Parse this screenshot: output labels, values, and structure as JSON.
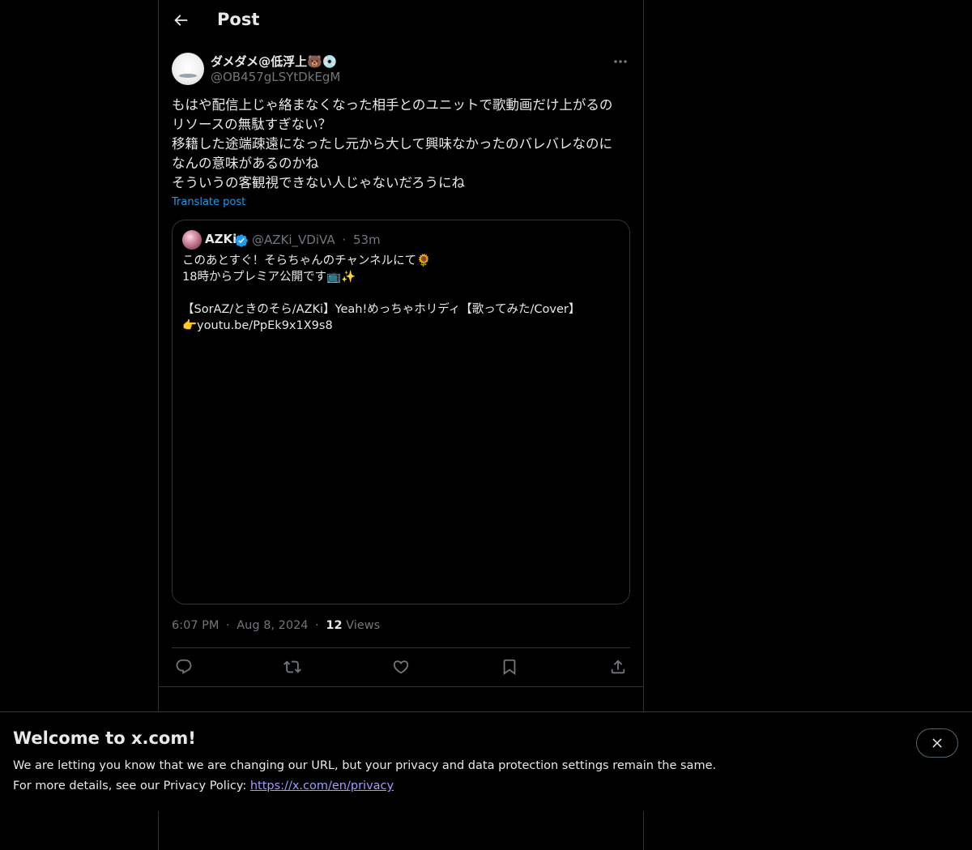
{
  "header": {
    "title": "Post"
  },
  "post": {
    "author": {
      "display_name": "ダメダメ@低浮上🐻💿",
      "handle": "@OB457gLSYtDkEgM"
    },
    "text": "もはや配信上じゃ絡まなくなった相手とのユニットで歌動画だけ上がるの\nリソースの無駄すぎない？\n移籍した途端疎遠になったし元から大して興味なかったのバレバレなのに\nなんの意味があるのかね\nそういうの客観視できない人じゃないだろうにね",
    "translate_label": "Translate post",
    "quoted": {
      "name": "AZKi",
      "handle": "@AZKi_VDiVA",
      "separator": "·",
      "time": "53m",
      "text": "このあとすぐ！そらちゃんのチャンネルにて🌻\n18時からプレミア公開です📺✨\n\n【SorAZ/ときのそら/AZKi】Yeah!めっちゃホリディ【歌ってみた/Cover】\n👉youtu.be/PpEk9x1X9s8"
    },
    "time": "6:07 PM",
    "date": "Aug 8, 2024",
    "separator": "·",
    "views_count": "12",
    "views_label": "Views"
  },
  "colors": {
    "background": "#000000",
    "text": "#e7e9ea",
    "muted": "#71767b",
    "accent": "#1d9bf0",
    "border": "#2f3336",
    "link": "#a29bfe"
  },
  "icons": {
    "back": "arrow-left-icon",
    "more": "more-dots-icon",
    "verified": "verified-badge-icon",
    "reply": "reply-icon",
    "retweet": "retweet-icon",
    "like": "heart-icon",
    "bookmark": "bookmark-icon",
    "share": "share-icon",
    "close": "close-icon"
  },
  "banner": {
    "title": "Welcome to x.com!",
    "line1": "We are letting you know that we are changing our URL, but your privacy and data protection settings remain the same.",
    "line2_prefix": "For more details, see our Privacy Policy: ",
    "privacy_link": "https://x.com/en/privacy"
  }
}
